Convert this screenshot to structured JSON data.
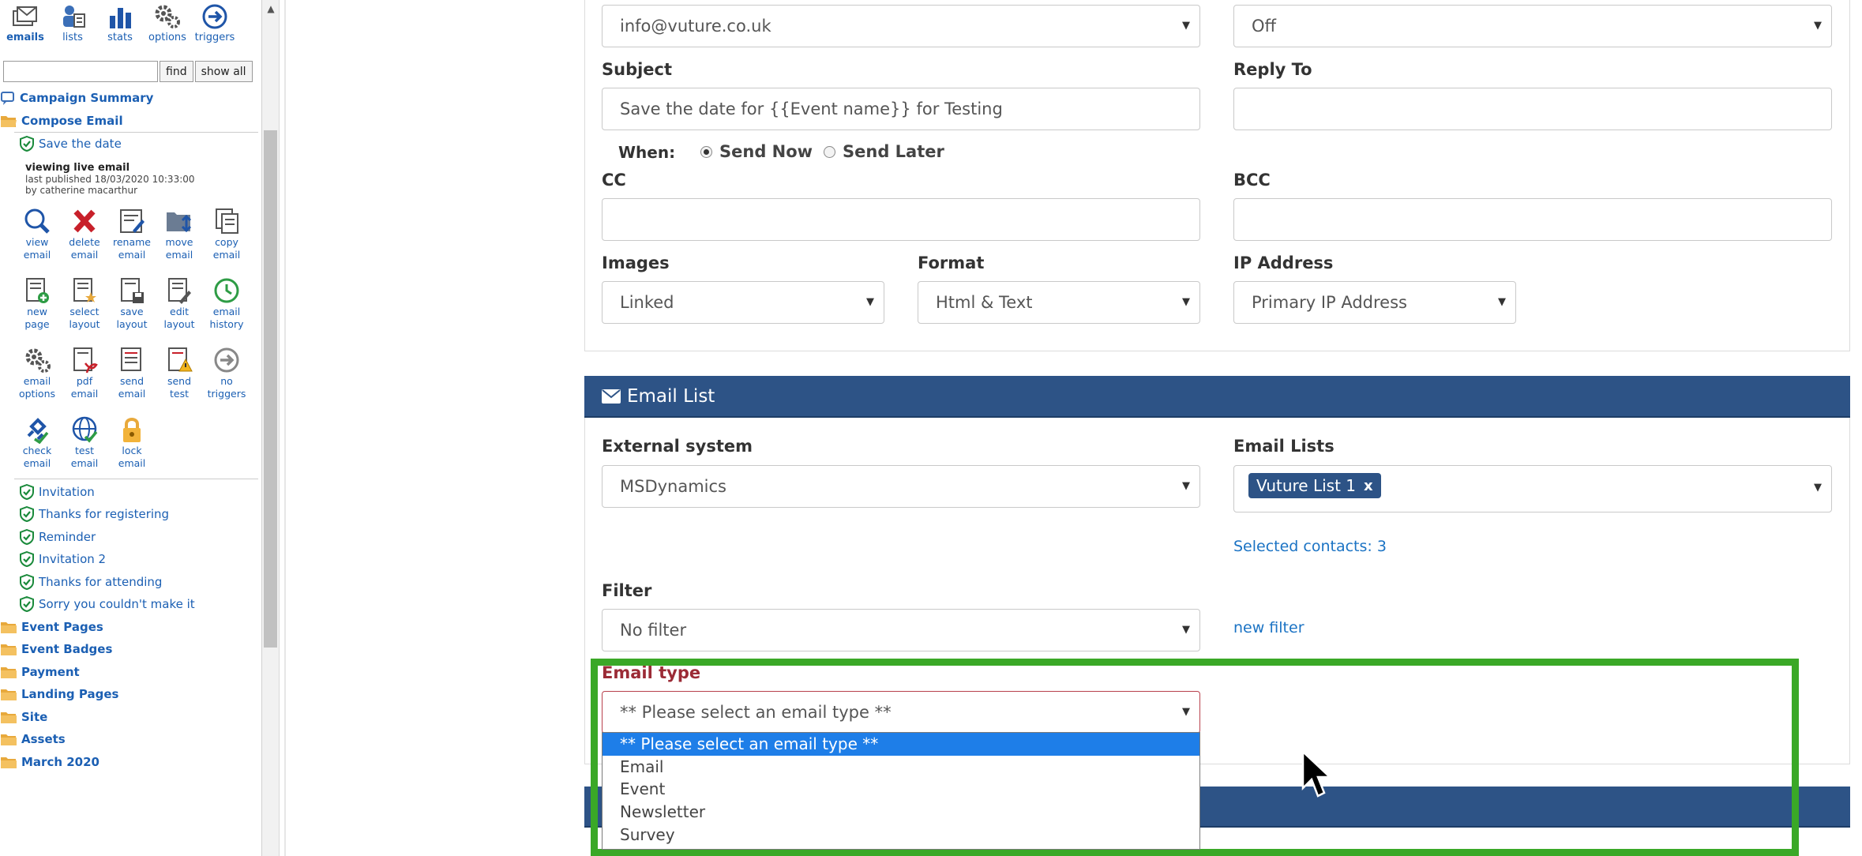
{
  "sidebar": {
    "topnav": [
      {
        "label": "emails",
        "icon": "emails-icon",
        "active": true
      },
      {
        "label": "lists",
        "icon": "lists-icon"
      },
      {
        "label": "stats",
        "icon": "stats-icon"
      },
      {
        "label": "options",
        "icon": "options-gear-icon"
      },
      {
        "label": "triggers",
        "icon": "triggers-arrow-icon"
      }
    ],
    "find_button": "find",
    "showall_button": "show all",
    "campaign_summary": "Campaign Summary",
    "compose_email": "Compose Email",
    "save_the_date": "Save the date",
    "viewing": {
      "title": "viewing  live  email",
      "published": "last published 18/03/2020 10:33:00",
      "by": "by catherine macarthur"
    },
    "actions": [
      {
        "l1": "view",
        "l2": "email",
        "icon": "view-email-icon"
      },
      {
        "l1": "delete",
        "l2": "email",
        "icon": "delete-email-icon"
      },
      {
        "l1": "rename",
        "l2": "email",
        "icon": "rename-email-icon"
      },
      {
        "l1": "move",
        "l2": "email",
        "icon": "move-email-icon"
      },
      {
        "l1": "copy",
        "l2": "email",
        "icon": "copy-email-icon"
      },
      {
        "l1": "new",
        "l2": "page",
        "icon": "new-page-icon"
      },
      {
        "l1": "select",
        "l2": "layout",
        "icon": "select-layout-icon"
      },
      {
        "l1": "save",
        "l2": "layout",
        "icon": "save-layout-icon"
      },
      {
        "l1": "edit",
        "l2": "layout",
        "icon": "edit-layout-icon"
      },
      {
        "l1": "email",
        "l2": "history",
        "icon": "email-history-icon"
      },
      {
        "l1": "email",
        "l2": "options",
        "icon": "email-options-icon"
      },
      {
        "l1": "pdf",
        "l2": "email",
        "icon": "pdf-email-icon"
      },
      {
        "l1": "send",
        "l2": "email",
        "icon": "send-email-icon"
      },
      {
        "l1": "send",
        "l2": "test",
        "icon": "send-test-icon"
      },
      {
        "l1": "no",
        "l2": "triggers",
        "icon": "no-triggers-icon"
      },
      {
        "l1": "check",
        "l2": "email",
        "icon": "check-email-icon"
      },
      {
        "l1": "test",
        "l2": "email",
        "icon": "test-email-icon"
      },
      {
        "l1": "lock",
        "l2": "email",
        "icon": "lock-email-icon"
      }
    ],
    "emails": [
      "Invitation",
      "Thanks for registering",
      "Reminder",
      "Invitation 2",
      "Thanks for attending",
      "Sorry you couldn't make it"
    ],
    "folders": [
      "Event Pages",
      "Event Badges",
      "Payment",
      "Landing Pages",
      "Site",
      "Assets",
      "March 2020"
    ]
  },
  "form": {
    "from_value": "info@vuture.co.uk",
    "top_right_value": "Off",
    "subject_label": "Subject",
    "subject_value": "Save the date for {{Event name}} for Testing",
    "replyto_label": "Reply To",
    "when_label": "When:",
    "send_now": "Send Now",
    "send_later": "Send Later",
    "cc_label": "CC",
    "bcc_label": "BCC",
    "images_label": "Images",
    "images_value": "Linked",
    "format_label": "Format",
    "format_value": "Html & Text",
    "ip_label": "IP Address",
    "ip_value": "Primary IP Address"
  },
  "email_list": {
    "header": "Email List",
    "external_label": "External system",
    "external_value": "MSDynamics",
    "lists_label": "Email Lists",
    "list_tag": "Vuture List 1",
    "tag_remove": "x",
    "selected_contacts": "Selected contacts: 3",
    "filter_label": "Filter",
    "filter_value": "No filter",
    "new_filter": "new filter",
    "email_type_label": "Email type",
    "email_type_value": "** Please select an email type **",
    "email_type_options": [
      "** Please select an email type **",
      "Email",
      "Event",
      "Newsletter",
      "Survey"
    ]
  },
  "colors": {
    "header_blue": "#2d5386",
    "link_blue": "#1b73c4",
    "highlight_green": "#3aa827",
    "selected_option": "#1e7ee8",
    "error_red": "#9b2b36"
  }
}
